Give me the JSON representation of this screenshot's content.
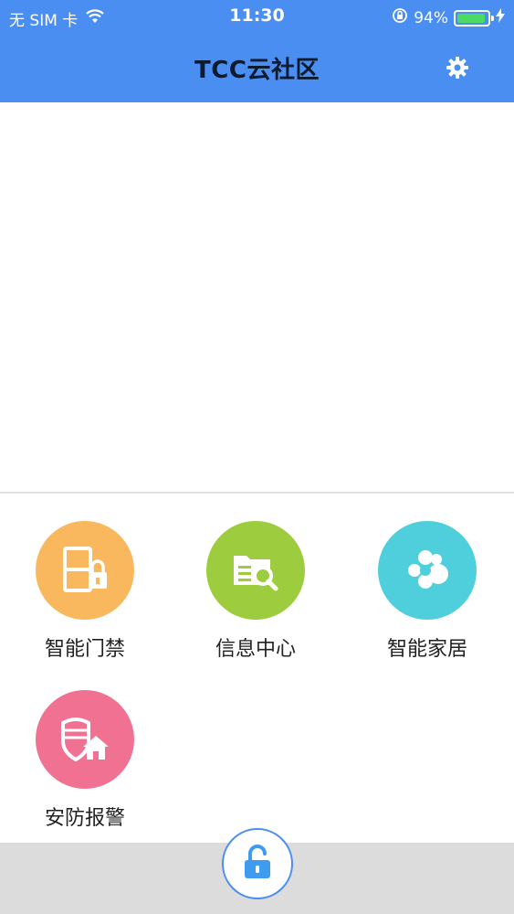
{
  "status_bar": {
    "carrier": "无 SIM 卡",
    "time": "11:30",
    "battery_percent": "94%",
    "battery_level": 0.94,
    "icons": [
      "wifi-icon",
      "orientation-lock-icon",
      "battery-icon",
      "charging-icon"
    ]
  },
  "nav": {
    "title": "TCC云社区",
    "settings_icon": "gear-icon"
  },
  "features": [
    {
      "label": "智能门禁",
      "color": "#f9b85e",
      "icon": "door-lock-icon"
    },
    {
      "label": "信息中心",
      "color": "#9dcc3f",
      "icon": "info-search-icon"
    },
    {
      "label": "智能家居",
      "color": "#4fcfdc",
      "icon": "smart-home-icon"
    },
    {
      "label": "安防报警",
      "color": "#f07191",
      "icon": "security-shield-icon"
    }
  ],
  "bottom": {
    "unlock_icon": "unlock-icon",
    "accent": "#4b8ef1"
  }
}
